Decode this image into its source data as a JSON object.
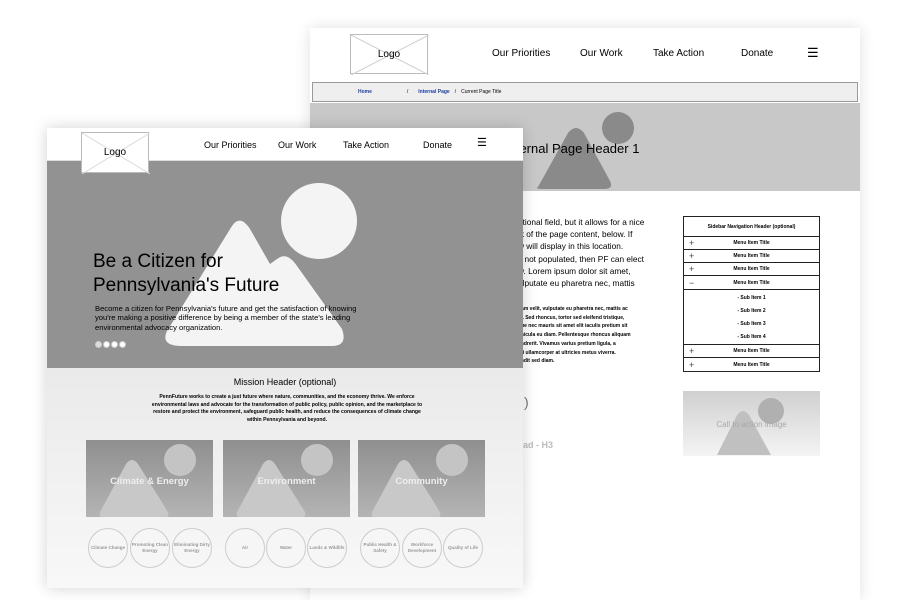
{
  "back_page": {
    "logo": "Logo",
    "nav": [
      "Our Priorities",
      "Our Work",
      "Take Action",
      "Donate"
    ],
    "menu_icon": "hamburger-icon",
    "breadcrumb": {
      "home": "Home",
      "internal": "Internal Page",
      "current": "Current Page Title",
      "separator": "/"
    },
    "page_header": "Internal Page Header 1",
    "intro_lines": [
      "otional field, but it allows for a nice",
      "lk of the page content, below. If",
      "w will display in this location.",
      "s not populated, then PF can elect",
      "w.   Lorem ipsum dolor sit amet,",
      "ulputate eu pharetra nec, mattis"
    ],
    "body_lines": [
      "uam velit, vulputate eu pharetra nec, mattis ac",
      "id. Sed rhoncus, tortor sed eleifend tristique,",
      "gue nec mauris sit amet elit iaculis pretium sit",
      "ehicula eu diam. Pellentesque rhoncus aliquam",
      "endrerit. Vivamus varius pretium ligula, a",
      "rci ullamcorper at ultricies metus viverra.",
      "andit sed diam."
    ],
    "section_fragment": ")",
    "h3_fragment": "ad - H3",
    "sidebar": {
      "header": "Sidebar Navigation Header (optional)",
      "items_before": [
        "Menu Item Title",
        "Menu Item Title",
        "Menu Item Title"
      ],
      "expanded": "Menu Item Title",
      "sub_items": [
        "- Sub Item 1",
        "- Sub Item 2",
        "- Sub Item 3",
        "- Sub Item 4"
      ],
      "items_after": [
        "Menu Item Title",
        "Menu Item Title"
      ]
    },
    "cta": "Call to action image"
  },
  "front_page": {
    "logo": "Logo",
    "nav": [
      "Our Priorities",
      "Our Work",
      "Take Action",
      "Donate"
    ],
    "menu_icon": "hamburger-icon",
    "hero": {
      "title_line1": "Be a Citizen for",
      "title_line2": "Pennsylvania's Future",
      "text": "Become a citizen for Pennsylvania's future and get the satisfaction of knowing you're making a positive difference by being a member of the state's leading environmental advocacy organization.",
      "slides": 4,
      "active_slide": 1
    },
    "mission": {
      "header": "Mission Header (optional)",
      "text": "PennFuture works to create a just future where nature, communities, and the economy thrive. We enforce environmental laws and advocate for the transformation of public policy, public opinion, and the marketplace to restore and protect the environment, safeguard public health, and reduce the consequences of climate change within Pennsylvania and beyond."
    },
    "categories": [
      {
        "title": "Climate & Energy",
        "subs": [
          "Climate Change",
          "Promoting Clean Energy",
          "Eliminating Dirty Energy"
        ]
      },
      {
        "title": "Environment",
        "subs": [
          "Air",
          "Water",
          "Lands & Wildlife"
        ]
      },
      {
        "title": "Community",
        "subs": [
          "Public Health & Safety",
          "Workforce Development",
          "Quality of Life"
        ]
      }
    ]
  }
}
